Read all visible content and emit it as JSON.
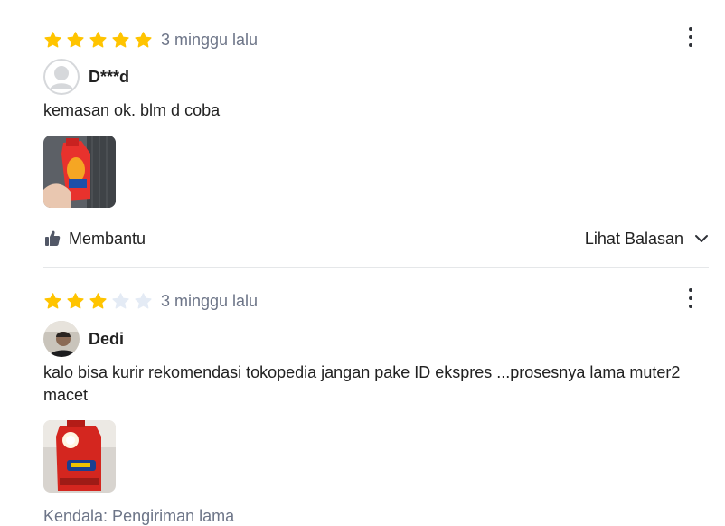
{
  "colors": {
    "star_filled": "#FFC400",
    "star_empty": "#E4EBF5",
    "muted_text": "#6D7588",
    "divider": "#E5E7E9"
  },
  "reviews": [
    {
      "rating": 5,
      "max_rating": 5,
      "time": "3 minggu lalu",
      "username": "D***d",
      "text": "kemasan ok. blm d coba",
      "helpful_label": "Membantu",
      "replies_label": "Lihat Balasan",
      "icons": {
        "menu": "more-vertical-icon",
        "helpful": "thumbs-up-icon",
        "replies": "chevron-down-icon"
      }
    },
    {
      "rating": 3,
      "max_rating": 5,
      "time": "3 minggu lalu",
      "username": "Dedi",
      "text": "kalo bisa kurir rekomendasi tokopedia jangan pake ID ekspres ...prosesnya lama muter2 macet",
      "issue": "Kendala: Pengiriman lama",
      "icons": {
        "menu": "more-vertical-icon"
      }
    }
  ]
}
